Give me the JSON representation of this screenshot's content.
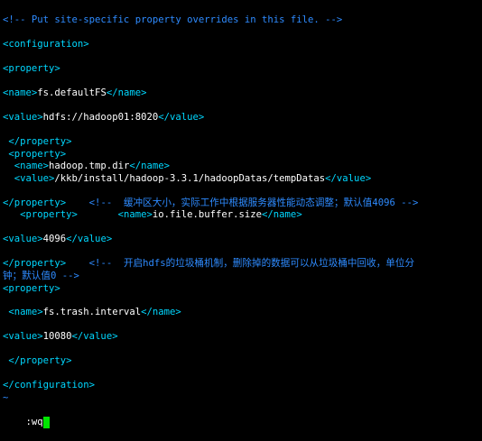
{
  "colors": {
    "background": "#000000",
    "tag": "#00d7ff",
    "comment": "#2e8bff",
    "text": "#ffffff",
    "cursor": "#00e600"
  },
  "lines": [
    {
      "segments": [
        {
          "cls": "comment",
          "t": "<!-- Put site-specific property overrides in this file. -->"
        }
      ]
    },
    {
      "segments": [
        {
          "cls": "tag",
          "t": "<configuration>"
        }
      ]
    },
    {
      "segments": [
        {
          "cls": "tag",
          "t": "<property>"
        }
      ]
    },
    {
      "segments": [
        {
          "cls": "tag",
          "t": "<name>"
        },
        {
          "cls": "text",
          "t": "fs.defaultFS"
        },
        {
          "cls": "tag",
          "t": "</name>"
        }
      ]
    },
    {
      "segments": [
        {
          "cls": "tag",
          "t": "<value>"
        },
        {
          "cls": "text",
          "t": "hdfs://hadoop01:8020"
        },
        {
          "cls": "tag",
          "t": "</value>"
        }
      ]
    },
    {
      "segments": [
        {
          "cls": "tag",
          "t": " </property>"
        }
      ]
    },
    {
      "segments": [
        {
          "cls": "tag",
          "t": " <property>"
        }
      ]
    },
    {
      "segments": [
        {
          "cls": "tag",
          "t": "  <name>"
        },
        {
          "cls": "text",
          "t": "hadoop.tmp.dir"
        },
        {
          "cls": "tag",
          "t": "</name>"
        }
      ]
    },
    {
      "segments": [
        {
          "cls": "tag",
          "t": "  <value>"
        },
        {
          "cls": "text",
          "t": "/kkb/install/hadoop-3.3.1/hadoopDatas/tempDatas"
        },
        {
          "cls": "tag",
          "t": "</value>"
        }
      ]
    },
    {
      "segments": [
        {
          "cls": "tag",
          "t": "</property>"
        },
        {
          "cls": "comment",
          "t": "    <!--  缓冲区大小，实际工作中根据服务器性能动态调整；默认值4096 -->"
        }
      ]
    },
    {
      "segments": [
        {
          "cls": "tag",
          "t": "   <property>"
        },
        {
          "cls": "text",
          "t": "       "
        },
        {
          "cls": "tag",
          "t": "<name>"
        },
        {
          "cls": "text",
          "t": "io.file.buffer.size"
        },
        {
          "cls": "tag",
          "t": "</name>"
        }
      ]
    },
    {
      "segments": [
        {
          "cls": "tag",
          "t": "<value>"
        },
        {
          "cls": "text",
          "t": "4096"
        },
        {
          "cls": "tag",
          "t": "</value>"
        }
      ]
    },
    {
      "segments": [
        {
          "cls": "tag",
          "t": "</property>"
        },
        {
          "cls": "comment",
          "t": "    <!--  开启hdfs的垃圾桶机制，删除掉的数据可以从垃圾桶中回收，单位分"
        }
      ]
    },
    {
      "segments": [
        {
          "cls": "comment",
          "t": "钟；默认值0 -->"
        }
      ]
    },
    {
      "segments": [
        {
          "cls": "tag",
          "t": "<property>"
        }
      ]
    },
    {
      "segments": [
        {
          "cls": "tag",
          "t": " <name>"
        },
        {
          "cls": "text",
          "t": "fs.trash.interval"
        },
        {
          "cls": "tag",
          "t": "</name>"
        }
      ]
    },
    {
      "segments": [
        {
          "cls": "tag",
          "t": "<value>"
        },
        {
          "cls": "text",
          "t": "10080"
        },
        {
          "cls": "tag",
          "t": "</value>"
        }
      ]
    },
    {
      "segments": [
        {
          "cls": "tag",
          "t": " </property>"
        }
      ]
    },
    {
      "segments": [
        {
          "cls": "tag",
          "t": "</configuration>"
        }
      ]
    },
    {
      "segments": [
        {
          "cls": "tilde",
          "t": "~"
        }
      ]
    }
  ],
  "command_line": {
    "text": ":wq"
  }
}
